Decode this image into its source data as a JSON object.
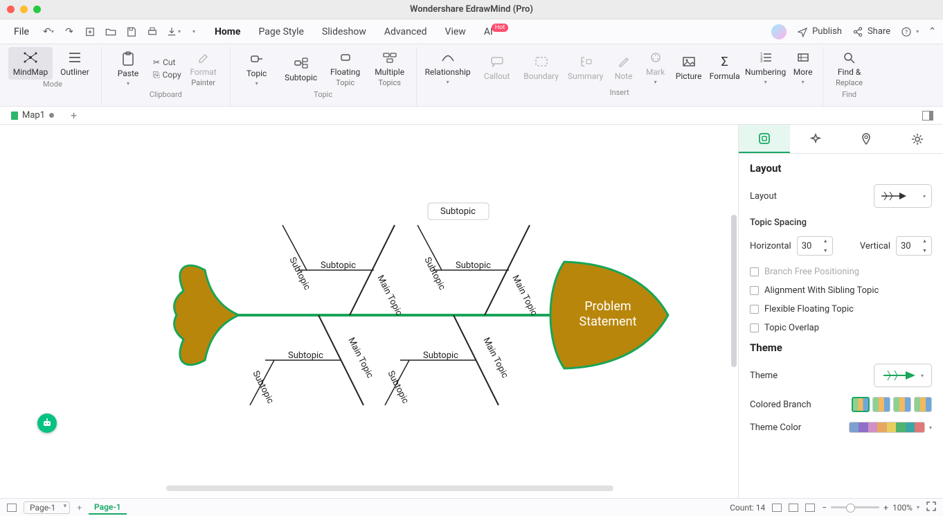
{
  "app": {
    "title": "Wondershare EdrawMind (Pro)"
  },
  "menubar": {
    "file": "File",
    "tabs": [
      "Home",
      "Page Style",
      "Slideshow",
      "Advanced",
      "View",
      "AI"
    ],
    "active_tab": "Home",
    "ai_badge": "Hot",
    "publish": "Publish",
    "share": "Share"
  },
  "ribbon": {
    "mode": {
      "label": "Mode",
      "mindmap": "MindMap",
      "outliner": "Outliner"
    },
    "clipboard": {
      "label": "Clipboard",
      "paste": "Paste",
      "cut": "Cut",
      "copy": "Copy",
      "format_painter_l1": "Format",
      "format_painter_l2": "Painter"
    },
    "topic": {
      "label": "Topic",
      "topic": "Topic",
      "subtopic": "Subtopic",
      "floating_l1": "Floating",
      "floating_l2": "Topic",
      "multiple_l1": "Multiple",
      "multiple_l2": "Topics"
    },
    "insert": {
      "label": "Insert",
      "relationship": "Relationship",
      "callout": "Callout",
      "boundary": "Boundary",
      "summary": "Summary",
      "note": "Note",
      "mark": "Mark",
      "picture": "Picture",
      "formula": "Formula",
      "numbering": "Numbering",
      "more": "More"
    },
    "find": {
      "label": "Find",
      "find_l1": "Find &",
      "find_l2": "Replace"
    }
  },
  "doctabs": {
    "name": "Map1",
    "plus": "+"
  },
  "fishbone": {
    "head": "Problem\nStatement",
    "main_topic": "Main Topic",
    "subtopic": "Subtopic"
  },
  "side": {
    "layout_h": "Layout",
    "layout_l": "Layout",
    "topic_spacing": "Topic Spacing",
    "horizontal": "Horizontal",
    "h_val": "30",
    "vertical": "Vertical",
    "v_val": "30",
    "branch_free": "Branch Free Positioning",
    "align_sibling": "Alignment With Sibling Topic",
    "flex_float": "Flexible Floating Topic",
    "overlap": "Topic Overlap",
    "theme_h": "Theme",
    "theme_l": "Theme",
    "colored_branch": "Colored Branch",
    "theme_color": "Theme Color"
  },
  "status": {
    "page_dd": "Page-1",
    "page_tab": "Page-1",
    "count": "Count: 14",
    "zoom": "100%"
  },
  "colors": {
    "fish_fill": "#b8860b",
    "fish_stroke": "#18a558",
    "bone": "#222222",
    "themebar": [
      "#7c9fd1",
      "#8f6fc7",
      "#d28fc7",
      "#e6a860",
      "#e6cf60",
      "#4fb36f",
      "#3aa6a6",
      "#e07878"
    ]
  }
}
